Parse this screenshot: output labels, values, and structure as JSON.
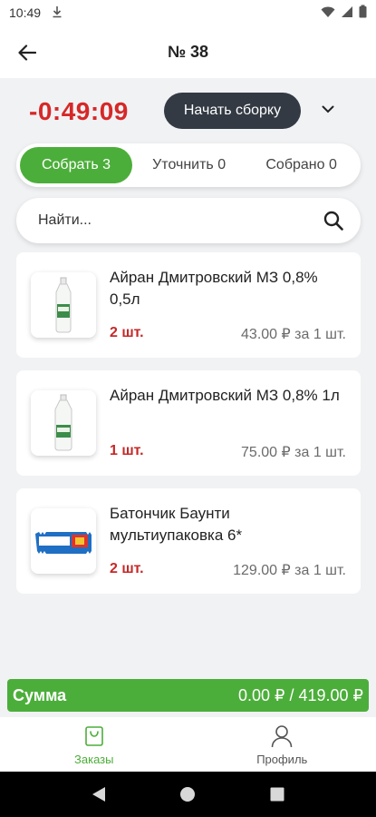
{
  "status_bar": {
    "time": "10:49"
  },
  "header": {
    "title": "№ 38"
  },
  "timer": {
    "value": "-0:49:09",
    "start_button": "Начать сборку"
  },
  "tabs": [
    {
      "label": "Собрать 3",
      "active": true
    },
    {
      "label": "Уточнить 0",
      "active": false
    },
    {
      "label": "Собрано 0",
      "active": false
    }
  ],
  "search": {
    "placeholder": "Найти..."
  },
  "products": [
    {
      "name": "Айран Дмитровский МЗ 0,8% 0,5л",
      "qty": "2 шт.",
      "price": "43.00 ₽ за 1 шт."
    },
    {
      "name": "Айран Дмитровский МЗ 0,8% 1л",
      "qty": "1 шт.",
      "price": "75.00 ₽ за 1 шт."
    },
    {
      "name": "Батончик Баунти мультиупаковка 6*",
      "qty": "2 шт.",
      "price": "129.00 ₽ за 1 шт."
    }
  ],
  "summary": {
    "label": "Сумма",
    "value": "0.00 ₽ / 419.00 ₽"
  },
  "bottom_nav": [
    {
      "label": "Заказы",
      "icon": "bag-icon",
      "active": true
    },
    {
      "label": "Профиль",
      "icon": "person-icon",
      "active": false
    }
  ],
  "colors": {
    "accent": "#4cae3a",
    "timer": "#d62828",
    "qty": "#c62828",
    "dark_button": "#333a44"
  }
}
